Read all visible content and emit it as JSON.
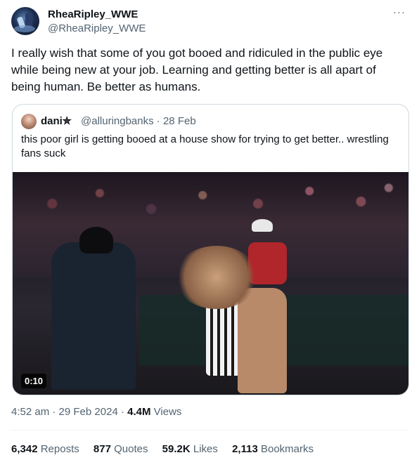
{
  "author": {
    "name": "RheaRipley_WWE",
    "handle": "@RheaRipley_WWE"
  },
  "more_label": "···",
  "tweet_text": "I really wish that some of you got booed and ridiculed in the public eye while being new at your job. Learning and getting better is all apart of being human. Be better as humans.",
  "quote": {
    "name": "dani✮",
    "handle": "@alluringbanks",
    "date": "28 Feb",
    "text": "this poor girl is getting booed at a house show for trying to get better.. wrestling fans suck",
    "video_duration": "0:10"
  },
  "timestamp": {
    "time": "4:52 am",
    "date": "29 Feb 2024",
    "views_count": "4.4M",
    "views_label": "Views"
  },
  "stats": [
    {
      "count": "6,342",
      "label": "Reposts"
    },
    {
      "count": "877",
      "label": "Quotes"
    },
    {
      "count": "59.2K",
      "label": "Likes"
    },
    {
      "count": "2,113",
      "label": "Bookmarks"
    }
  ]
}
